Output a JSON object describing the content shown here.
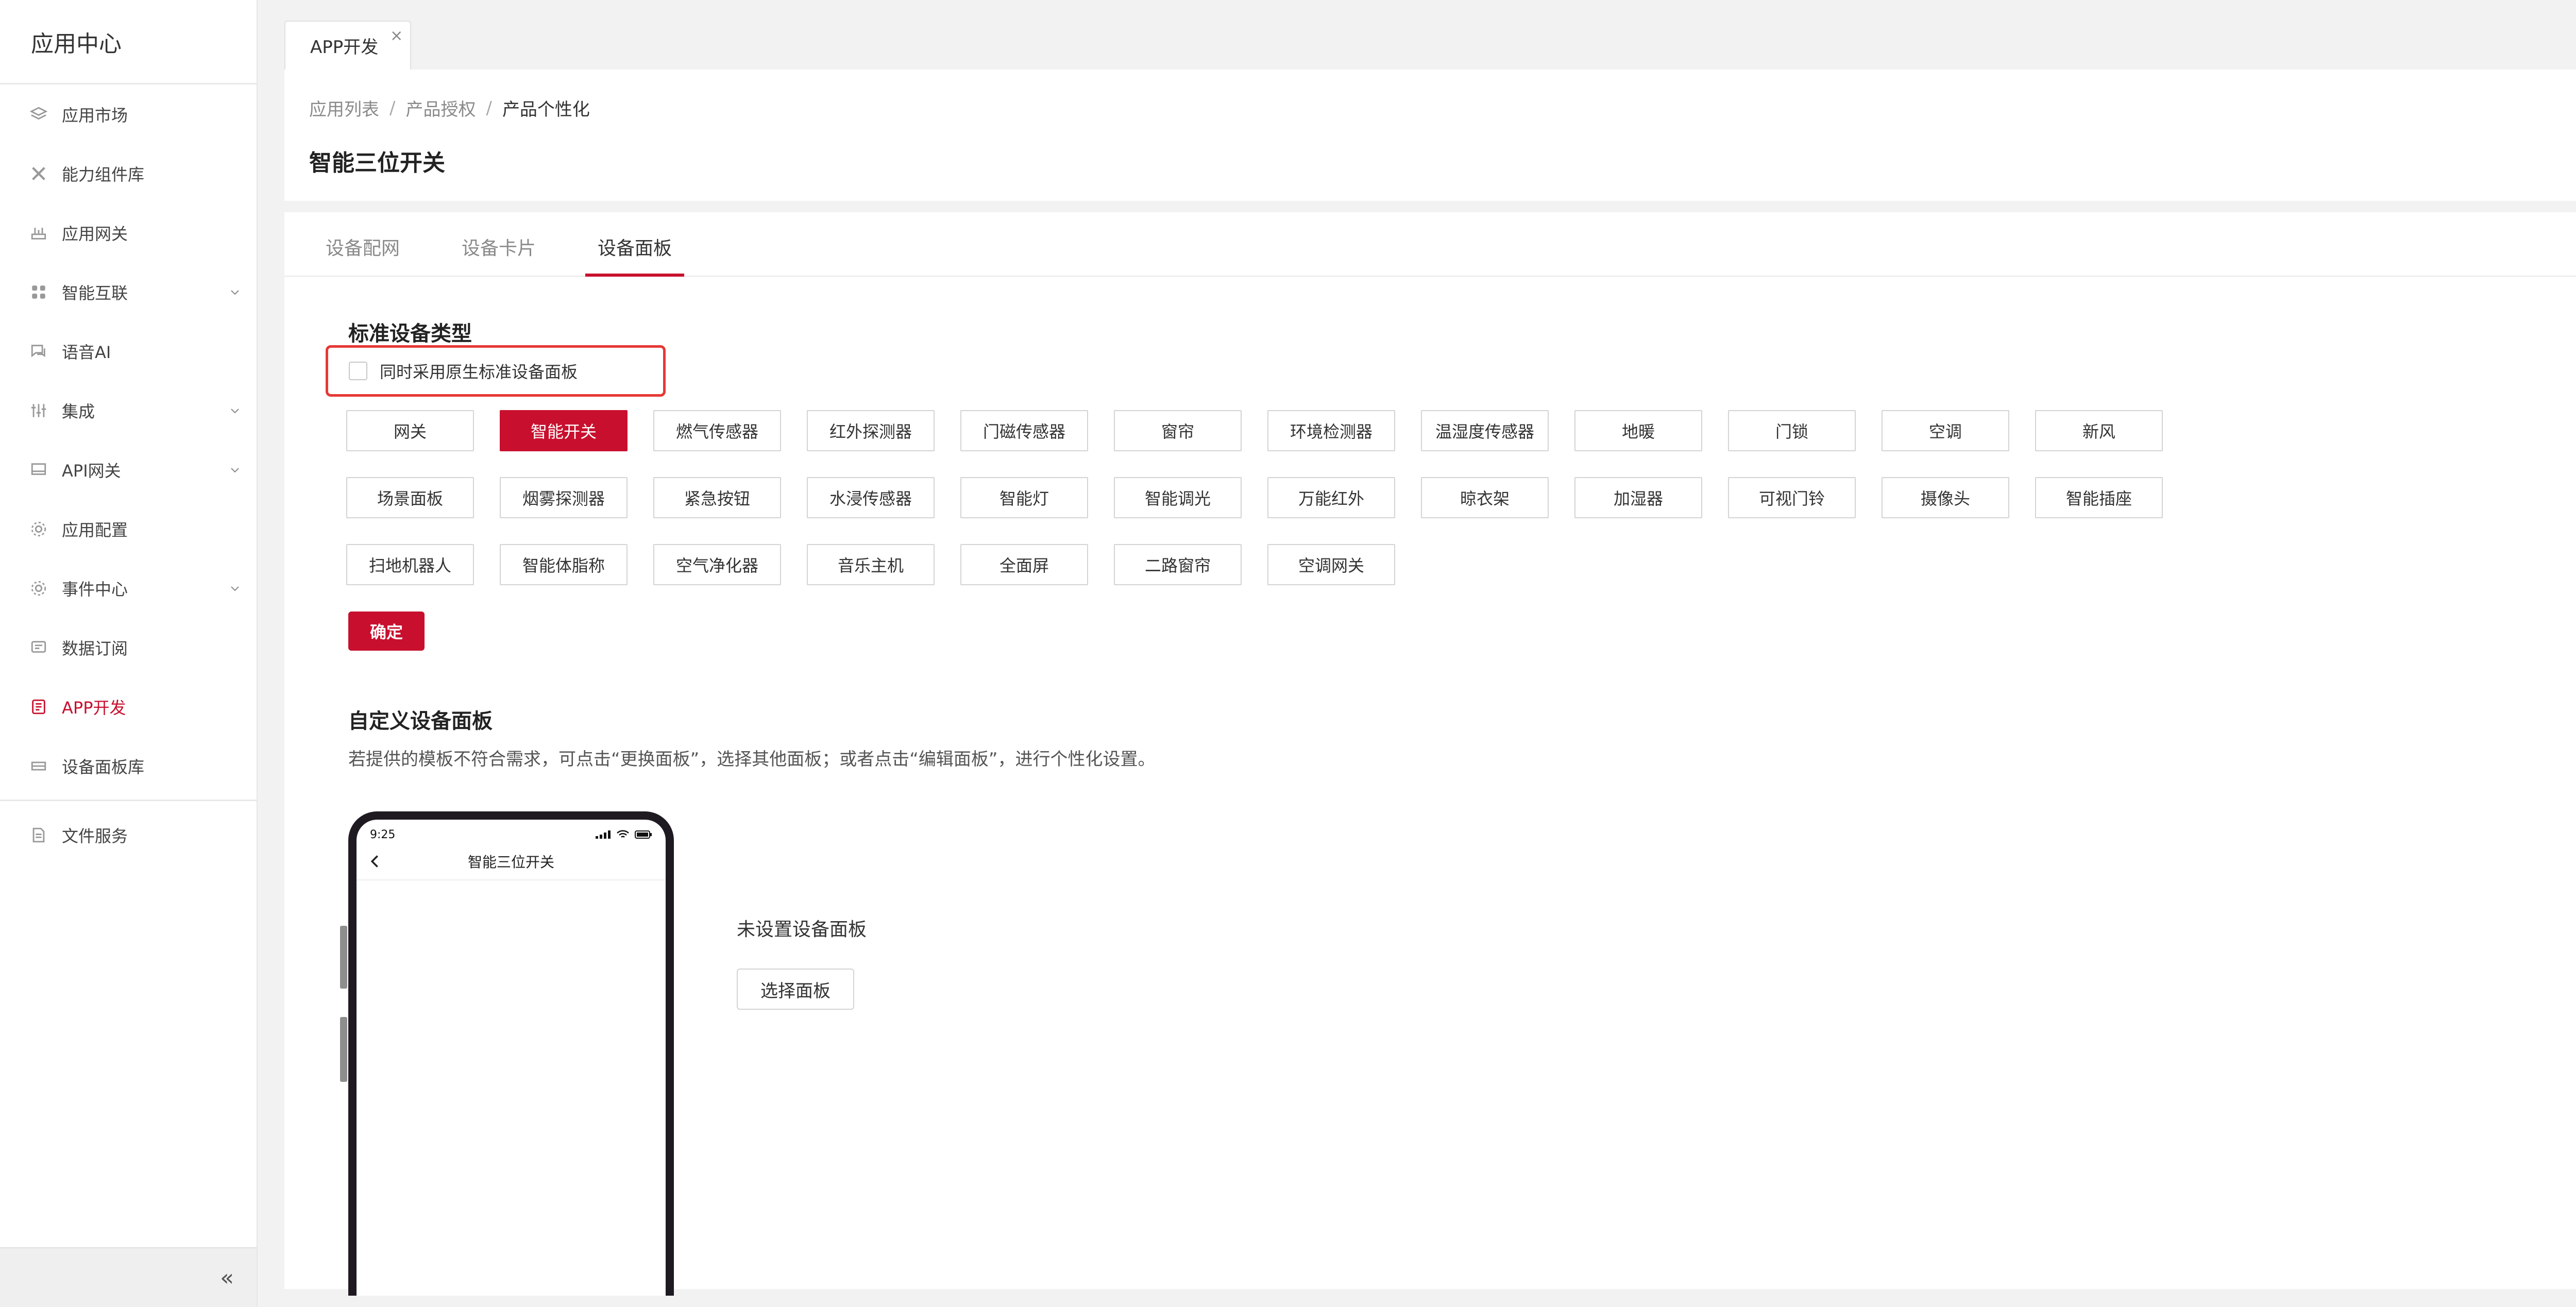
{
  "sidebar": {
    "title": "应用中心",
    "items": [
      {
        "label": "应用市场",
        "icon": "layers-icon",
        "expandable": false
      },
      {
        "label": "能力组件库",
        "icon": "tools-icon",
        "expandable": false
      },
      {
        "label": "应用网关",
        "icon": "router-icon",
        "expandable": false
      },
      {
        "label": "智能互联",
        "icon": "apps-grid-icon",
        "expandable": true
      },
      {
        "label": "语音AI",
        "icon": "chat-icon",
        "expandable": false
      },
      {
        "label": "集成",
        "icon": "sliders-icon",
        "expandable": true
      },
      {
        "label": "API网关",
        "icon": "api-gateway-icon",
        "expandable": true
      },
      {
        "label": "应用配置",
        "icon": "gear-icon",
        "expandable": false
      },
      {
        "label": "事件中心",
        "icon": "gear-alt-icon",
        "expandable": true
      },
      {
        "label": "数据订阅",
        "icon": "subscription-icon",
        "expandable": false
      },
      {
        "label": "APP开发",
        "icon": "app-dev-icon",
        "expandable": false,
        "active": true
      },
      {
        "label": "设备面板库",
        "icon": "panel-icon",
        "expandable": false
      },
      {
        "label": "文件服务",
        "icon": "file-icon",
        "expandable": false
      }
    ],
    "collapse_glyph": "«"
  },
  "page_tab": {
    "label": "APP开发",
    "close_glyph": "×"
  },
  "breadcrumb": {
    "items": [
      "应用列表",
      "产品授权",
      "产品个性化"
    ],
    "separator": "/"
  },
  "page_title": "智能三位开关",
  "tabs": [
    {
      "label": "设备配网",
      "active": false
    },
    {
      "label": "设备卡片",
      "active": false
    },
    {
      "label": "设备面板",
      "active": true
    }
  ],
  "standard": {
    "title": "标准设备类型",
    "native_checkbox_label": "同时采用原生标准设备面板",
    "native_checked": false,
    "device_types": [
      {
        "label": "网关"
      },
      {
        "label": "智能开关",
        "selected": true
      },
      {
        "label": "燃气传感器"
      },
      {
        "label": "红外探测器"
      },
      {
        "label": "门磁传感器"
      },
      {
        "label": "窗帘"
      },
      {
        "label": "环境检测器"
      },
      {
        "label": "温湿度传感器"
      },
      {
        "label": "地暖"
      },
      {
        "label": "门锁"
      },
      {
        "label": "空调"
      },
      {
        "label": "新风"
      },
      {
        "label": "场景面板"
      },
      {
        "label": "烟雾探测器"
      },
      {
        "label": "紧急按钮"
      },
      {
        "label": "水浸传感器"
      },
      {
        "label": "智能灯"
      },
      {
        "label": "智能调光"
      },
      {
        "label": "万能红外"
      },
      {
        "label": "晾衣架"
      },
      {
        "label": "加湿器"
      },
      {
        "label": "可视门铃"
      },
      {
        "label": "摄像头"
      },
      {
        "label": "智能插座"
      },
      {
        "label": "扫地机器人"
      },
      {
        "label": "智能体脂称"
      },
      {
        "label": "空气净化器"
      },
      {
        "label": "音乐主机"
      },
      {
        "label": "全面屏"
      },
      {
        "label": "二路窗帘"
      },
      {
        "label": "空调网关"
      }
    ],
    "confirm_label": "确定"
  },
  "custom": {
    "title": "自定义设备面板",
    "description": "若提供的模板不符合需求，可点击“更换面板”，选择其他面板；或者点击“编辑面板”，进行个性化设置。",
    "phone": {
      "time": "9:25",
      "title": "智能三位开关"
    },
    "unset_label": "未设置设备面板",
    "select_button": "选择面板"
  },
  "colors": {
    "accent": "#c8102e",
    "highlight_border": "#e53935"
  }
}
